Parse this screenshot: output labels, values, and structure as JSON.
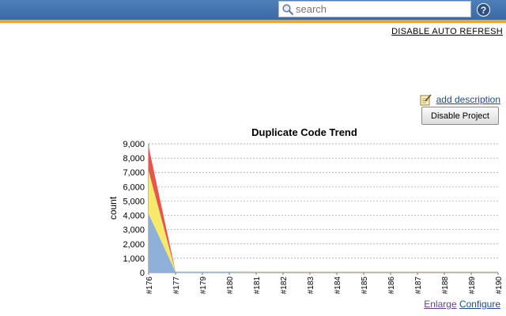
{
  "header": {
    "search_placeholder": "search",
    "help_symbol": "?"
  },
  "links": {
    "auto_refresh": "DISABLE AUTO REFRESH",
    "add_description": "add description",
    "enlarge": "Enlarge",
    "configure": "Configure"
  },
  "buttons": {
    "disable_project": "Disable Project"
  },
  "chart_data": {
    "type": "area",
    "title": "Duplicate Code Trend",
    "ylabel": "count",
    "xlabel": "",
    "ylim": [
      0,
      9000
    ],
    "yticks": [
      "0",
      "1,000",
      "2,000",
      "3,000",
      "4,000",
      "5,000",
      "6,000",
      "7,000",
      "8,000",
      "9,000"
    ],
    "categories": [
      "#176",
      "#177",
      "#179",
      "#180",
      "#181",
      "#182",
      "#183",
      "#184",
      "#185",
      "#186",
      "#187",
      "#188",
      "#189",
      "#190"
    ],
    "series": [
      {
        "values": [
          4100,
          50,
          50,
          50,
          30,
          30,
          30,
          30,
          30,
          30,
          30,
          30,
          30,
          30
        ],
        "color": "#8fb0d8"
      },
      {
        "values": [
          3000,
          20,
          20,
          20,
          20,
          20,
          20,
          20,
          20,
          20,
          20,
          20,
          20,
          20
        ],
        "color": "#f6e96b"
      },
      {
        "values": [
          1700,
          10,
          10,
          10,
          10,
          10,
          10,
          10,
          10,
          10,
          10,
          10,
          10,
          10
        ],
        "color": "#e8554d"
      }
    ],
    "grid": true,
    "grid_style": "dashed"
  }
}
